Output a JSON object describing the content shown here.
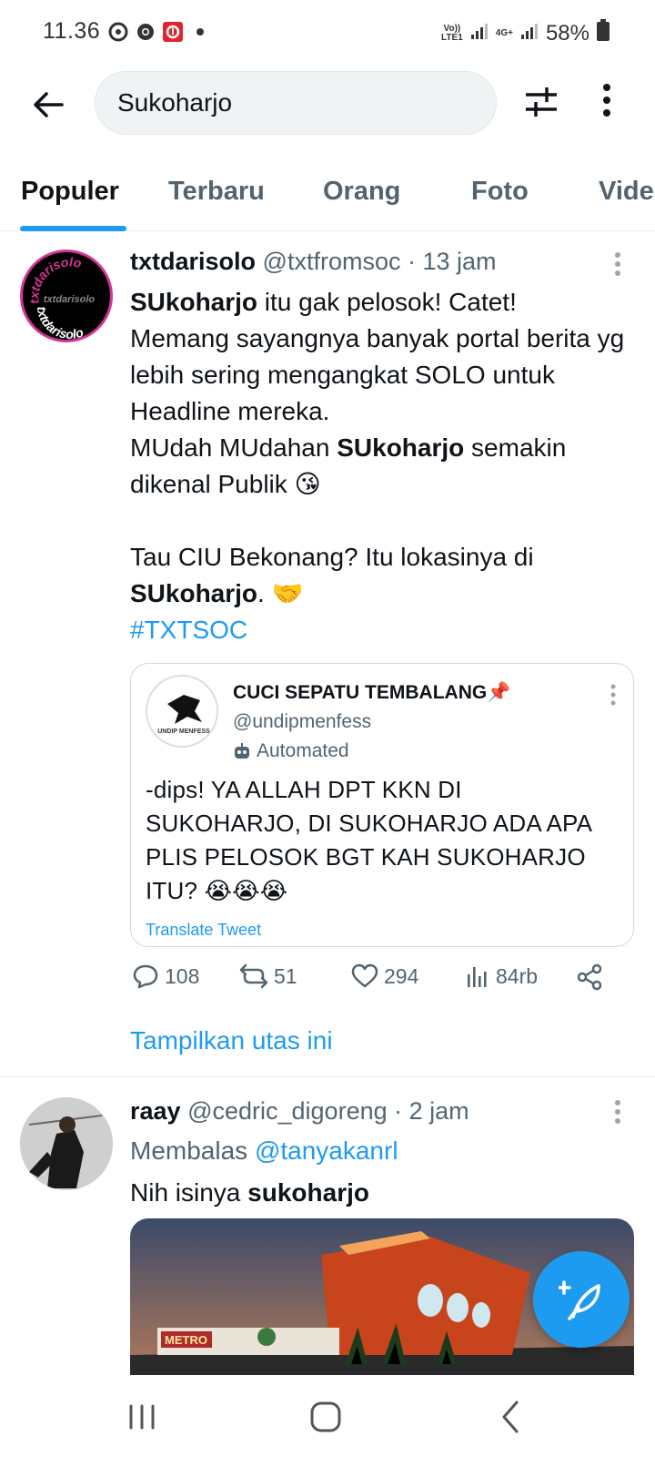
{
  "status_bar": {
    "time": "11.36",
    "volte_label": "Vo))\nLTE1",
    "network_label": "4G+",
    "battery": "58%"
  },
  "search": {
    "query": "Sukoharjo"
  },
  "tabs": [
    {
      "label": "Populer",
      "active": true
    },
    {
      "label": "Terbaru",
      "active": false
    },
    {
      "label": "Orang",
      "active": false
    },
    {
      "label": "Foto",
      "active": false
    },
    {
      "label": "Video",
      "active": false
    }
  ],
  "tweet1": {
    "avatar_text_top": "txtdarisolo",
    "avatar_text_mid": "txtdarisolo",
    "avatar_text_bottom": "txtdarisolo",
    "name": "txtdarisolo",
    "handle": "@txtfromsoc",
    "time": " · 13 jam",
    "line1_bold": "SUkoharjo",
    "line1_rest": " itu gak pelosok! Catet!",
    "line2": "Memang sayangnya banyak portal berita yg lebih sering mengangkat SOLO untuk Headline mereka.",
    "line3_a": "MUdah MUdahan ",
    "line3_bold": "SUkoharjo",
    "line3_b": " semakin dikenal Publik 😘",
    "line4": "Tau CIU Bekonang? Itu lokasinya di",
    "line5_bold": "SUkoharjo",
    "line5_rest": ". 🤝",
    "hashtag": "#TXTSOC",
    "quote": {
      "avatar_label": "UNDIP MENFESS",
      "name": "CUCI SEPATU TEMBALANG📌",
      "handle": "@undipmenfess",
      "automated": "Automated",
      "text": "-dips! YA ALLAH DPT KKN DI SUKOHARJO, DI SUKOHARJO ADA APA PLIS PELOSOK BGT KAH SUKOHARJO ITU? 😭😭😭",
      "translate": "Translate Tweet"
    },
    "replies": "108",
    "retweets": "51",
    "likes": "294",
    "views": "84rb",
    "show_thread": "Tampilkan utas ini"
  },
  "tweet2": {
    "name": "raay",
    "handle": "@cedric_digoreng",
    "time": " · 2 jam",
    "reply_prefix": "Membalas ",
    "reply_to": "@tanyakanrl",
    "text_a": "Nih isinya ",
    "text_bold": "sukoharjo",
    "image_sign": "METRO"
  },
  "colors": {
    "accent": "#1d9bf0",
    "text": "#0f1419",
    "secondary": "#536471"
  }
}
